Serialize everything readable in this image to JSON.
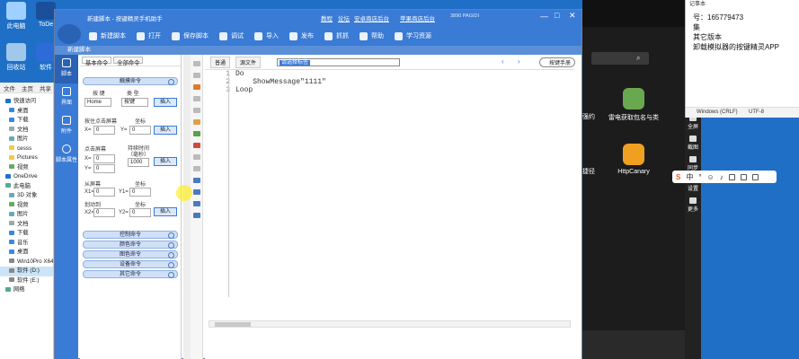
{
  "desktop": {
    "icons": [
      {
        "label": "此电脑",
        "color": "#9fd0ff"
      },
      {
        "label": "ToDe",
        "color": "#1b4f9a"
      },
      {
        "label": "回收站",
        "color": "#9fc8ea"
      },
      {
        "label": "软件",
        "color": "#2b6cd8"
      }
    ]
  },
  "explorer": {
    "tabs": [
      "文件",
      "主页",
      "共享"
    ],
    "nav": [
      {
        "label": "快速访问",
        "color": "#1a6fd8"
      },
      {
        "label": "桌面",
        "color": "#3a88e0",
        "sub": true
      },
      {
        "label": "下载",
        "color": "#3a88e0",
        "sub": true
      },
      {
        "label": "文档",
        "color": "#9aa",
        "sub": true
      },
      {
        "label": "图片",
        "color": "#6ab",
        "sub": true
      },
      {
        "label": "cesss",
        "color": "#f2c94c",
        "sub": true
      },
      {
        "label": "Pictures",
        "color": "#f2c94c",
        "sub": true
      },
      {
        "label": "视频",
        "color": "#6a6",
        "sub": true
      },
      {
        "label": "OneDrive",
        "color": "#1a6fd8"
      },
      {
        "label": "此电脑",
        "color": "#5a9"
      },
      {
        "label": "3D 对象",
        "color": "#6ab",
        "sub": true
      },
      {
        "label": "视频",
        "color": "#6a6",
        "sub": true
      },
      {
        "label": "图片",
        "color": "#6ab",
        "sub": true
      },
      {
        "label": "文档",
        "color": "#9aa",
        "sub": true
      },
      {
        "label": "下载",
        "color": "#3a88e0",
        "sub": true
      },
      {
        "label": "音乐",
        "color": "#3a88e0",
        "sub": true
      },
      {
        "label": "桌面",
        "color": "#3a88e0",
        "sub": true
      },
      {
        "label": "Win10Pro X64 (",
        "color": "#888",
        "sub": true
      },
      {
        "label": "软件 (D:)",
        "color": "#888",
        "sub": true,
        "selected": true
      },
      {
        "label": "软件 (E:)",
        "color": "#888",
        "sub": true
      },
      {
        "label": "网络",
        "color": "#5a8"
      }
    ]
  },
  "app": {
    "title": "新建脚本 - 按键精灵手机助手",
    "title_links": [
      "教程",
      "论坛",
      "安卓商店后台",
      "苹果商店后台"
    ],
    "phone_status": "3890 PAGIDI",
    "toolbar": [
      "新建脚本",
      "打开",
      "保存脚本",
      "调试",
      "导入",
      "发布",
      "抓抓",
      "帮助",
      "学习资源"
    ],
    "subtitle": "新建脚本",
    "leftbar": [
      "脚本",
      "界面",
      "附件",
      "脚本属性"
    ],
    "cmd_tabs": [
      "基本命令",
      "全部命令"
    ],
    "groups_top": "触摸命令",
    "form": {
      "key_label": "按 键",
      "type_label": "类 型",
      "key_value": "Home",
      "type_value": "按键",
      "insert": "插入",
      "tap_label": "按住点击屏幕",
      "coord_label": "坐标",
      "x_label": "X=",
      "y_label": "Y=",
      "zero": "0",
      "hold_label": "点击屏幕",
      "duration_label": "持续时间",
      "duration_unit": "（毫秒）",
      "duration_value": "1000",
      "swipe_label": "从屏幕",
      "x1_label": "X1=",
      "y1_label": "Y1=",
      "to_label": "划动到",
      "x2_label": "X2=",
      "y2_label": "Y2="
    },
    "groups_bottom": [
      "控制命令",
      "颜色命令",
      "图色命令",
      "设备命令",
      "其它命令"
    ],
    "editor_tabs": [
      "普通",
      "源文件"
    ],
    "combo_value": "请选择标签",
    "manual_button": "按键手册",
    "code": [
      {
        "n": "1",
        "text": "Do"
      },
      {
        "n": "2",
        "text": "    ShowMessage\"1111\""
      },
      {
        "n": "3",
        "text": "Loop"
      }
    ]
  },
  "emulator": {
    "apps": [
      {
        "label": "雷电获取包名与类",
        "color": "#6aa84f"
      },
      {
        "label": "HttpCanary",
        "color": "#f0a020"
      }
    ],
    "partial_labels": [
      "强约",
      "捷径"
    ],
    "side_buttons": [
      "键",
      "截图",
      "全屏",
      "减量",
      "加量",
      "全屏",
      "截图",
      "同步",
      "设置",
      "更多"
    ]
  },
  "notepad": {
    "title": "记事本",
    "lines": [
      "号：165779473",
      "集",
      "其它版本",
      "卸载模拟器的按键精灵APP"
    ],
    "status": [
      "Windows (CRLF)",
      "UTF-8"
    ]
  },
  "ime": {
    "label": "中"
  }
}
